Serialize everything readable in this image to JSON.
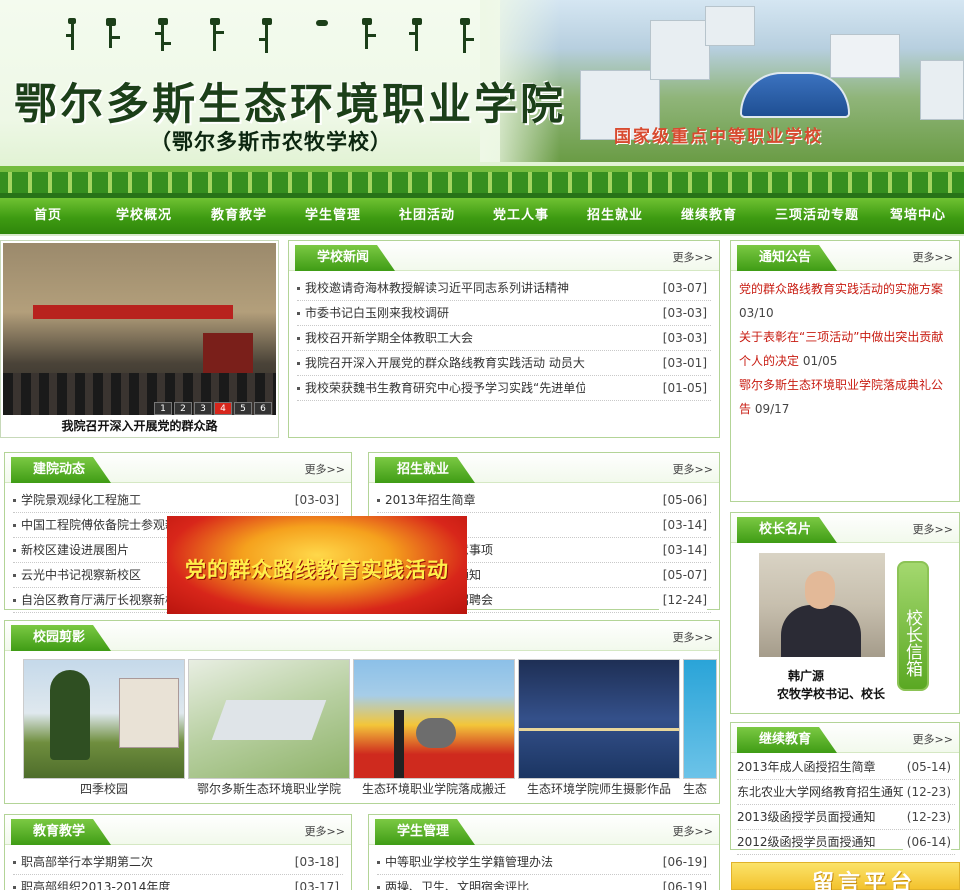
{
  "header": {
    "mongolian_script": "ᠣᠷᠳᠣᠰ ᠡᠭᠡᠯᠭᠡ ᠣᠷᠴᠢᠨ ᠲᠣᠭᠣᠷᠢᠨ ᠮᠡᠷᠭᠡᠵᠢᠯ ᠦᠨ ᠰᠤᠷᠭᠠᠭᠤᠯᠢ",
    "title": "鄂尔多斯生态环境职业学院",
    "subtitle": "（鄂尔多斯市农牧学校）",
    "slogan": "国家级重点中等职业学校"
  },
  "nav": {
    "items": [
      "首页",
      "学校概况",
      "教育教学",
      "学生管理",
      "社团活动",
      "党工人事",
      "招生就业",
      "继续教育",
      "三项活动专题",
      "驾培中心"
    ]
  },
  "slideshow": {
    "caption": "我院召开深入开展党的群众路",
    "dots": [
      "1",
      "2",
      "3",
      "4",
      "5",
      "6"
    ],
    "active": 4,
    "photo_banner": "鄂尔多斯生态环境职业学院党的群众路线教育实践活动动员大会"
  },
  "school_news": {
    "title": "学校新闻",
    "more": "更多>>",
    "items": [
      {
        "text": "我校邀请奇海林教授解读习近平同志系列讲话精神",
        "date": "[03-07]"
      },
      {
        "text": "市委书记白玉刚来我校调研",
        "date": "[03-03]"
      },
      {
        "text": "我校召开新学期全体教职工大会",
        "date": "[03-03]"
      },
      {
        "text": "我院召开深入开展党的群众路线教育实践活动 动员大会",
        "date": "[03-01]"
      },
      {
        "text": "我校荣获魏书生教育研究中心授予学习实践“先进单位”",
        "date": "[01-05]"
      }
    ]
  },
  "notice": {
    "title": "通知公告",
    "more": "更多>>",
    "items": [
      {
        "text": "党的群众路线教育实践活动的实施方案",
        "date": "03/10"
      },
      {
        "text": "关于表彰在“三项活动”中做出突出贡献个人的决定",
        "date": "01/05"
      },
      {
        "text": "鄂尔多斯生态环境职业学院落成典礼公告",
        "date": "09/17"
      }
    ]
  },
  "construction": {
    "title": "建院动态",
    "more": "更多>>",
    "items": [
      {
        "text": "学院景观绿化工程施工",
        "date": "[03-03]"
      },
      {
        "text": "中国工程院傅依备院士参观新",
        "date": ""
      },
      {
        "text": "新校区建设进展图片",
        "date": ""
      },
      {
        "text": "云光中书记视察新校区",
        "date": ""
      },
      {
        "text": "自治区教育厅满厅长视察新校",
        "date": ""
      }
    ]
  },
  "employment": {
    "title": "招生就业",
    "more": "更多>>",
    "items": [
      {
        "text": "2013年招生简章",
        "date": "[05-06]"
      },
      {
        "text": "",
        "date": "[03-14]"
      },
      {
        "text": "名单及报到注意事项",
        "date": "[03-14]"
      },
      {
        "text": "源盛光电入职通知",
        "date": "[05-07]"
      },
      {
        "text": "生化有限公司招聘会",
        "date": "[12-24]"
      }
    ]
  },
  "principal": {
    "title": "校长名片",
    "more": "更多>>",
    "name": "韩广源",
    "role": "农牧学校书记、校长",
    "mailbox": "校长信箱"
  },
  "gallery": {
    "title": "校园剪影",
    "more": "更多>>",
    "items": [
      "四季校园",
      "鄂尔多斯生态环境职业学院",
      "生态环境职业学院落成搬迁",
      "生态环境学院师生摄影作品",
      "生态"
    ]
  },
  "continuing": {
    "title": "继续教育",
    "more": "更多>>",
    "items": [
      {
        "text": "2013年成人函授招生简章",
        "date": "(05-14)"
      },
      {
        "text": "东北农业大学网络教育招生通知",
        "date": "(12-23)"
      },
      {
        "text": "2013级函授学员面授通知",
        "date": "(12-23)"
      },
      {
        "text": "2012级函授学员面授通知",
        "date": "(06-14)"
      }
    ]
  },
  "teaching": {
    "title": "教育教学",
    "more": "更多>>",
    "items": [
      {
        "text": "职高部举行本学期第二次",
        "date": "[03-18]"
      },
      {
        "text": "职高部组织2013-2014年度",
        "date": "[03-17]"
      }
    ]
  },
  "student": {
    "title": "学生管理",
    "more": "更多>>",
    "items": [
      {
        "text": "中等职业学校学生学籍管理办法",
        "date": "[06-19]"
      },
      {
        "text": "两操、卫生、文明宿舍评比",
        "date": "[06-19]"
      }
    ]
  },
  "popup": {
    "text": "党的群众路线教育实践活动"
  },
  "message_board": {
    "text": "留言平台"
  },
  "colors": {
    "primary_green": "#3e9b12",
    "accent_red": "#c81c12"
  }
}
